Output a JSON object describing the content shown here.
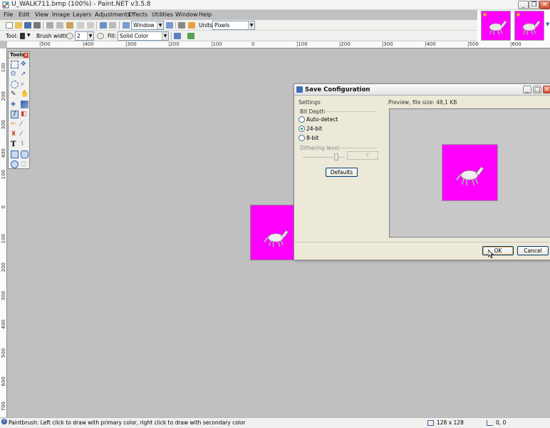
{
  "window": {
    "title": "U_WALK711.bmp (100%) - Paint.NET v3.5.8"
  },
  "menu": [
    "File",
    "Edit",
    "View",
    "Image",
    "Layers",
    "Adjustments",
    "Effects",
    "Utilities",
    "Window",
    "Help"
  ],
  "toolbar1": {
    "zoom_value": "Window",
    "units_label": "Units:",
    "units_value": "Pixels"
  },
  "toolbar2": {
    "tool_label": "Tool:",
    "brush_width_label": "Brush width:",
    "brush_width_value": "2",
    "fill_label": "Fill:",
    "fill_value": "Solid Color"
  },
  "rulers": {
    "horizontal": [
      "|500",
      "|400",
      "|300",
      "|200",
      "|100",
      "0",
      "|100",
      "|200",
      "|300",
      "|400",
      "|500",
      "|600"
    ],
    "vertical": [
      "100",
      "200",
      "300",
      "400",
      "100",
      "0",
      "100",
      "200",
      "300",
      "400",
      "500",
      "600",
      "700"
    ]
  },
  "tools_window": {
    "title": "Tools"
  },
  "dialog": {
    "title": "Save Configuration",
    "settings_label": "Settings",
    "bit_depth_label": "Bit Depth",
    "options": [
      "Auto-detect",
      "24-bit",
      "8-bit"
    ],
    "selected": "24-bit",
    "dithering_label": "Dithering level",
    "dithering_value": "7",
    "defaults_label": "Defaults",
    "preview_label": "Preview, file size: 48,1 KB",
    "ok_label": "OK",
    "cancel_label": "Cancel"
  },
  "status": {
    "hint": "Paintbrush: Left click to draw with primary color, right click to draw with secondary color",
    "image_size": "128 x 128",
    "cursor_pos": "0, 0"
  },
  "colors": {
    "image_bg": "#ff00ff",
    "accent": "#3d6ea8"
  },
  "icons": [
    "horse-sprite-icon",
    "paint-net-icon",
    "close-icon",
    "maximize-icon",
    "minimize-icon"
  ]
}
